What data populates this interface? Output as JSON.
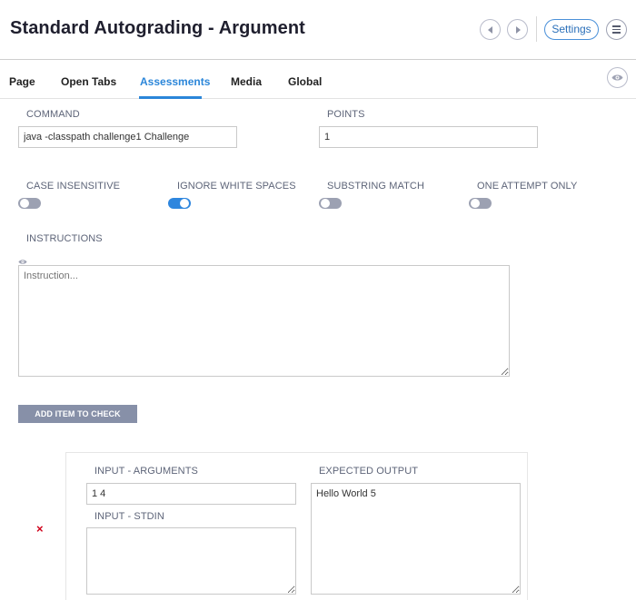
{
  "header": {
    "title": "Standard Autograding - Argument",
    "settings_label": "Settings"
  },
  "tabs": [
    {
      "label": "Page"
    },
    {
      "label": "Open Tabs"
    },
    {
      "label": "Assessments"
    },
    {
      "label": "Media"
    },
    {
      "label": "Global"
    }
  ],
  "form": {
    "command_label": "COMMAND",
    "command_value": "java -classpath challenge1 Challenge",
    "points_label": "POINTS",
    "points_value": "1",
    "toggles": [
      {
        "label": "CASE INSENSITIVE",
        "on": false
      },
      {
        "label": "IGNORE WHITE SPACES",
        "on": true
      },
      {
        "label": "SUBSTRING MATCH",
        "on": false
      },
      {
        "label": "ONE ATTEMPT ONLY",
        "on": false
      }
    ],
    "instructions_label": "INSTRUCTIONS",
    "instructions_placeholder": "Instruction...",
    "add_item_label": "ADD ITEM TO CHECK"
  },
  "check_item": {
    "arguments_label": "INPUT - ARGUMENTS",
    "arguments_value": "1 4",
    "stdin_label": "INPUT - STDIN",
    "stdin_value": "",
    "expected_label": "EXPECTED OUTPUT",
    "expected_value": "Hello World 5",
    "remove_symbol": "×"
  },
  "colors": {
    "accent": "#2b86d9",
    "toggle_off": "#9ca1b2",
    "button": "#8790a8",
    "remove": "#d0021b"
  }
}
